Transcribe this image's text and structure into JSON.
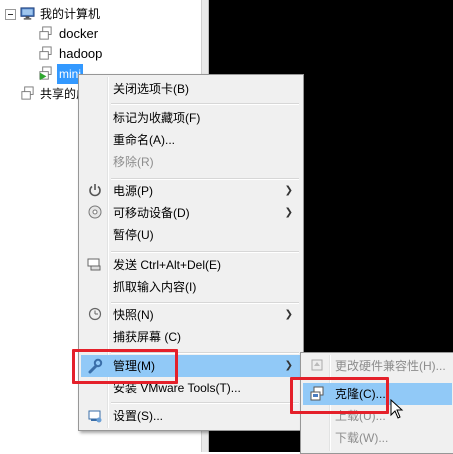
{
  "tree": {
    "root_label": "我的计算机",
    "vms": [
      "docker",
      "hadoop"
    ],
    "selected_vm": "mini",
    "shared_label": "共享的虚"
  },
  "context_menu": {
    "items": {
      "close_tab": "关闭选项卡(B)",
      "favorite": "标记为收藏项(F)",
      "rename": "重命名(A)...",
      "remove": "移除(R)",
      "power": "电源(P)",
      "removable": "可移动设备(D)",
      "pause": "暂停(U)",
      "send_cad": "发送 Ctrl+Alt+Del(E)",
      "grab_input": "抓取输入内容(I)",
      "snapshot": "快照(N)",
      "capture_screen": "捕获屏幕 (C)",
      "manage": "管理(M)",
      "install_tools": "安装 VMware Tools(T)...",
      "settings": "设置(S)..."
    }
  },
  "submenu": {
    "items": {
      "change_hw": "更改硬件兼容性(H)...",
      "clone": "克隆(C)...",
      "upload": "上载(U)...",
      "download": "下载(W)..."
    }
  },
  "colors": {
    "highlight": "#91c9f7",
    "annotation_box": "#e4202a",
    "selection": "#3399ff"
  }
}
